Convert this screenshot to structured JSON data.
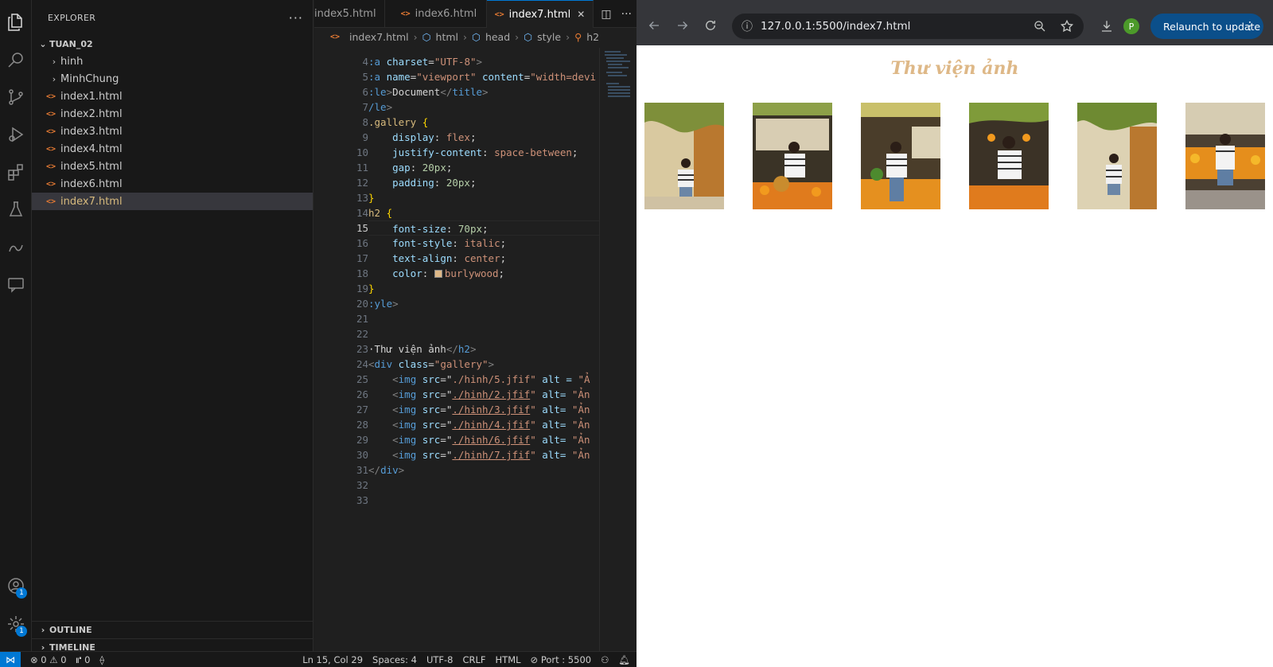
{
  "explorer": {
    "title": "EXPLORER",
    "project": "TUAN_02",
    "folders": [
      "hinh",
      "MinhChung"
    ],
    "files": [
      "index1.html",
      "index2.html",
      "index3.html",
      "index4.html",
      "index5.html",
      "index6.html",
      "index7.html"
    ],
    "selected": "index7.html",
    "outline": "OUTLINE",
    "timeline": "TIMELINE"
  },
  "activity_badges": {
    "accounts": "1",
    "settings": "1"
  },
  "editor": {
    "tabs": [
      {
        "label": "index5.html"
      },
      {
        "label": "index6.html"
      },
      {
        "label": "index7.html",
        "active": true
      }
    ],
    "close_glyph": "✕",
    "breadcrumbs": [
      "index7.html",
      "html",
      "head",
      "style",
      "h2"
    ],
    "line_numbers": [
      "4",
      "5",
      "6",
      "7",
      "8",
      "9",
      "10",
      "11",
      "12",
      "13",
      "14",
      "15",
      "16",
      "17",
      "18",
      "19",
      "20",
      "21",
      "22",
      "23",
      "24",
      "25",
      "26",
      "27",
      "28",
      "29",
      "30",
      "31",
      "32",
      "33"
    ],
    "current_line": "15"
  },
  "code": {
    "l4": [
      ":a",
      " charset",
      "=",
      "\"UTF-8\"",
      ">"
    ],
    "l5": [
      ":a",
      " name",
      "=",
      "\"viewport\"",
      " content",
      "=",
      "\"width=devi"
    ],
    "l6": [
      ":le",
      ">",
      "Document",
      "</",
      "title",
      ">"
    ],
    "l7": [
      "/le",
      ">"
    ],
    "l8": [
      ".gallery",
      " {"
    ],
    "l9": [
      "display",
      ": ",
      "flex",
      ";"
    ],
    "l10": [
      "justify-content",
      ": ",
      "space-between",
      ";"
    ],
    "l11": [
      "gap",
      ": ",
      "20px",
      ";"
    ],
    "l12": [
      "padding",
      ": ",
      "20px",
      ";"
    ],
    "l13": [
      "}"
    ],
    "l14": [
      "h2",
      " {"
    ],
    "l15": [
      "font-size",
      ": ",
      "70px",
      ";"
    ],
    "l16": [
      "font-style",
      ": ",
      "italic",
      ";"
    ],
    "l17": [
      "text-align",
      ": ",
      "center",
      ";"
    ],
    "l18": [
      "color",
      ": ",
      "burlywood",
      ";"
    ],
    "l19": [
      "}"
    ],
    "l20": [
      ":yle",
      ">"
    ],
    "l23": [
      "·Thư viện ảnh",
      "</",
      "h2",
      ">"
    ],
    "l24": [
      "<",
      "div",
      " class",
      "=",
      "\"gallery\"",
      ">"
    ],
    "img_rows": [
      {
        "src": "./hinh/5.jfif",
        "alt": " alt = ",
        "tail": "\"Ả"
      },
      {
        "src": "./hinh/2.jfif",
        "alt": " alt= ",
        "tail": "\"Ản"
      },
      {
        "src": "./hinh/3.jfif",
        "alt": " alt= ",
        "tail": "\"Ản"
      },
      {
        "src": "./hinh/4.jfif",
        "alt": " alt= ",
        "tail": "\"Ản"
      },
      {
        "src": "./hinh/6.jfif",
        "alt": " alt= ",
        "tail": "\"Ản"
      },
      {
        "src": "./hinh/7.jfif",
        "alt": " alt= ",
        "tail": "\"Ản"
      }
    ],
    "img_tag": "img",
    "src_attr": " src",
    "l31": [
      "</",
      "div",
      ">"
    ]
  },
  "statusbar": {
    "problems": "⊗ 0 ⚠ 0",
    "ports": "⑈ 0",
    "position": "Ln 15, Col 29",
    "spaces": "Spaces: 4",
    "encoding": "UTF-8",
    "eol": "CRLF",
    "language": "HTML",
    "port": "⊘ Port : 5500"
  },
  "browser": {
    "url": "127.0.0.1:5500/index7.html",
    "profile_initial": "P",
    "relaunch": "Relaunch to update",
    "page_heading": "Thư viện ảnh"
  },
  "colors": {
    "accent": "#0078d4",
    "heading": "#deb887",
    "html_icon": "#e37933"
  }
}
